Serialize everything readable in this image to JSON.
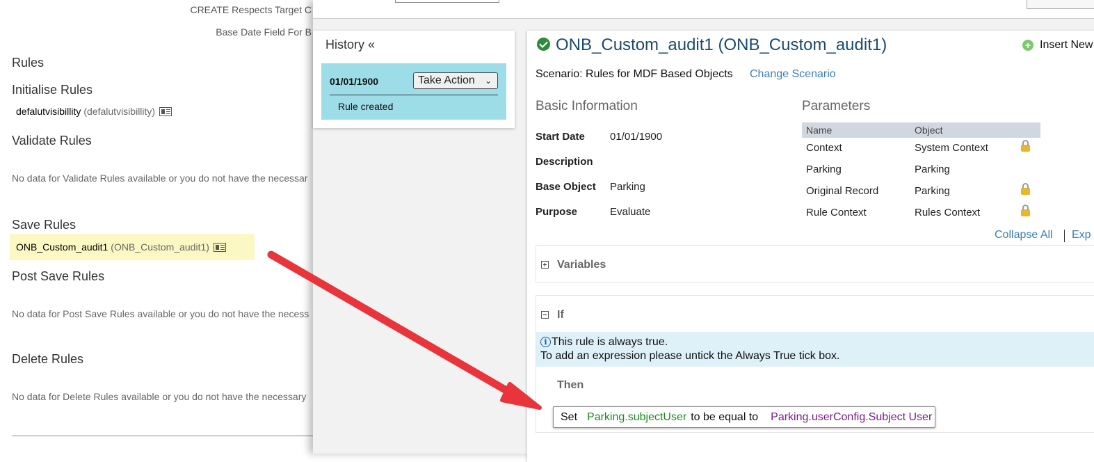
{
  "background_page": {
    "fields": [
      "CREATE Respects Target C",
      "Base Date Field For B"
    ],
    "rules_heading": "Rules",
    "initialise": {
      "title": "Initialise Rules",
      "rule_name": "defalutvisibillity",
      "rule_id": "(defalutvisibillity)"
    },
    "validate": {
      "title": "Validate Rules",
      "empty": "No data for Validate Rules available or you do not have the necessar"
    },
    "save": {
      "title": "Save Rules",
      "rule_name": "ONB_Custom_audit1",
      "rule_id": "(ONB_Custom_audit1)"
    },
    "post_save": {
      "title": "Post Save Rules",
      "empty": "No data for Post Save Rules available or you do not have the necess"
    },
    "delete": {
      "title": "Delete Rules",
      "empty": "No data for Delete Rules available or you do not have the necessary"
    }
  },
  "history": {
    "title": "History «",
    "entry_date": "01/01/1900",
    "take_action": "Take Action",
    "note": "Rule created"
  },
  "rule": {
    "title": "ONB_Custom_audit1 (ONB_Custom_audit1)",
    "insert_new": "Insert New",
    "scenario": "Scenario: Rules for MDF Based Objects",
    "change_scenario": "Change Scenario",
    "basic_info": {
      "heading": "Basic Information",
      "start_date_label": "Start Date",
      "start_date": "01/01/1900",
      "description_label": "Description",
      "base_object_label": "Base Object",
      "base_object": "Parking",
      "purpose_label": "Purpose",
      "purpose": "Evaluate"
    },
    "parameters": {
      "heading": "Parameters",
      "col_name": "Name",
      "col_object": "Object",
      "rows": [
        {
          "name": "Context",
          "object": "System Context",
          "locked": true
        },
        {
          "name": "Parking",
          "object": "Parking",
          "locked": false
        },
        {
          "name": "Original Record",
          "object": "Parking",
          "locked": true
        },
        {
          "name": "Rule Context",
          "object": "Rules Context",
          "locked": true
        }
      ]
    },
    "collapse_all": "Collapse All",
    "expand_all": "Exp",
    "variables_label": "Variables",
    "if_label": "If",
    "info_line1": "This rule is always true.",
    "info_line2": "To add an expression please untick the Always True tick box.",
    "then_label": "Then",
    "set_statement": {
      "set": "Set",
      "target": "Parking.subjectUser",
      "op": "to be equal to",
      "source": "Parking.userConfig.Subject User"
    }
  },
  "colors": {
    "history_entry_bg": "#9ddde8",
    "save_highlight_bg": "#fcf8c4",
    "link_blue": "#3c7fb8",
    "title_blue": "#1a4a6e",
    "arrow_red": "#e8343a",
    "token_green": "#1b8a1b",
    "token_purple": "#7a1a8c"
  }
}
